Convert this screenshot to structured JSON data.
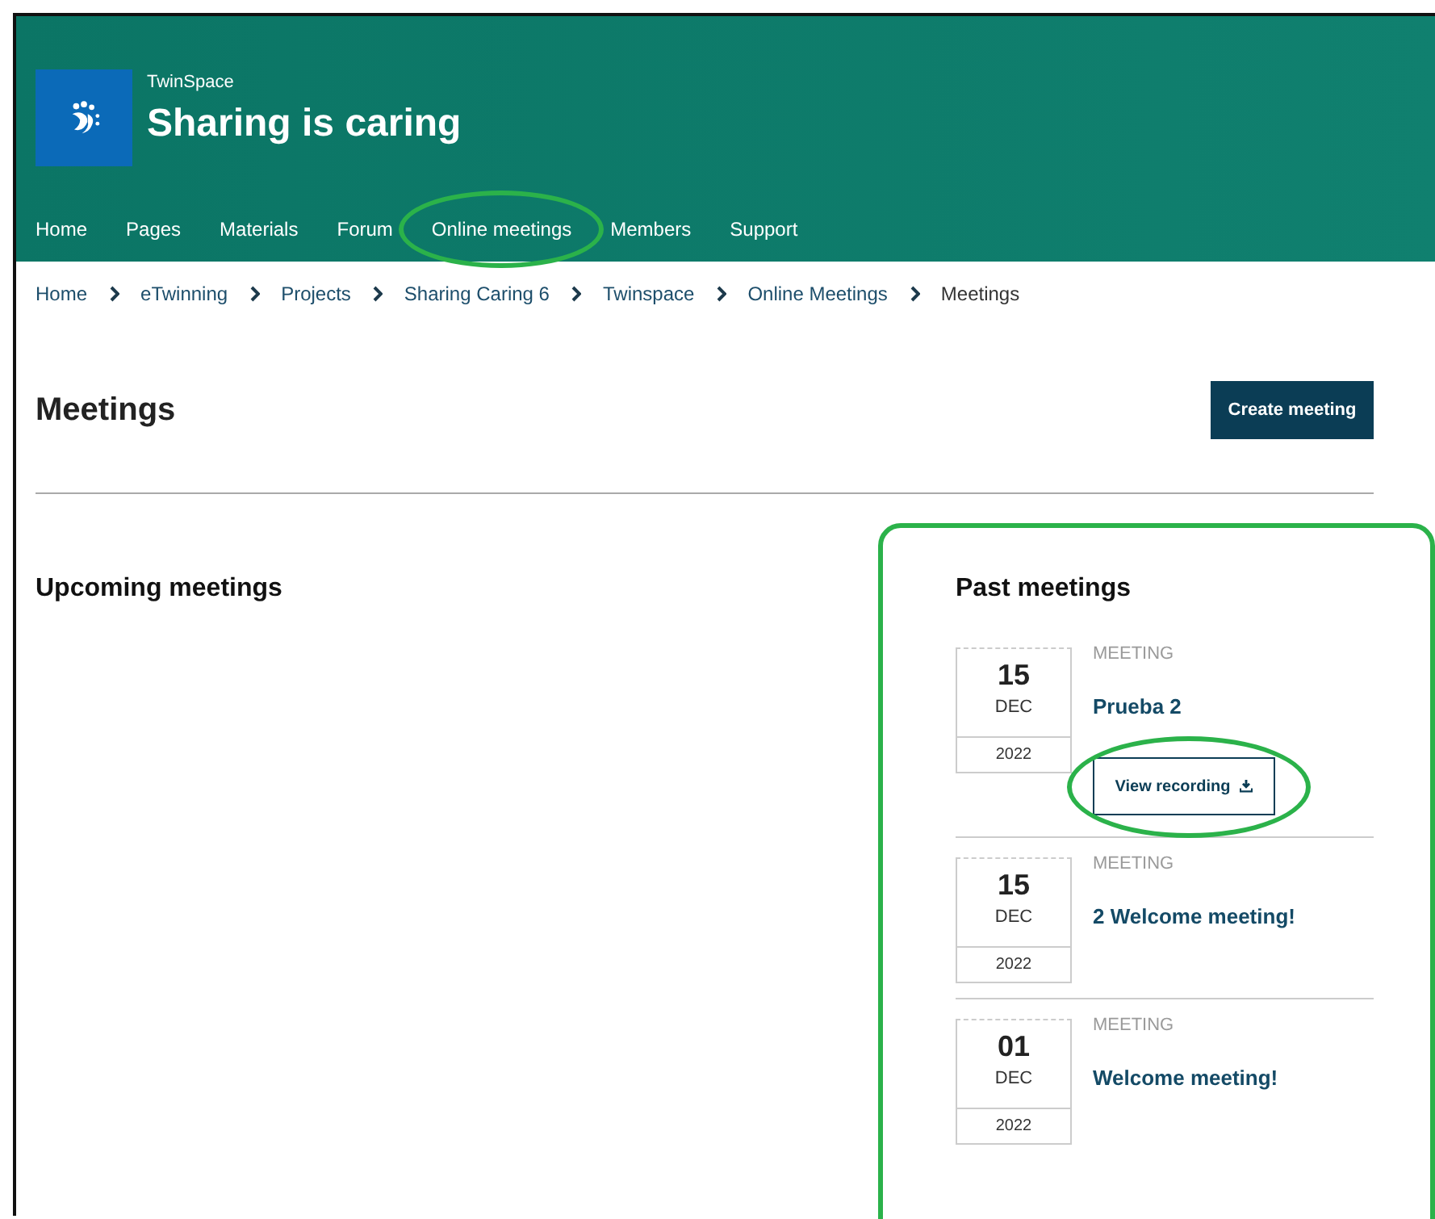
{
  "header": {
    "brand": "TwinSpace",
    "title": "Sharing is caring"
  },
  "nav_items": [
    {
      "label": "Home",
      "highlighted": false
    },
    {
      "label": "Pages",
      "highlighted": false
    },
    {
      "label": "Materials",
      "highlighted": false
    },
    {
      "label": "Forum",
      "highlighted": false
    },
    {
      "label": "Online meetings",
      "highlighted": true
    },
    {
      "label": "Members",
      "highlighted": false
    },
    {
      "label": "Support",
      "highlighted": false
    }
  ],
  "breadcrumb": [
    {
      "label": "Home",
      "link": true
    },
    {
      "label": "eTwinning",
      "link": true
    },
    {
      "label": "Projects",
      "link": true
    },
    {
      "label": "Sharing Caring 6",
      "link": true
    },
    {
      "label": "Twinspace",
      "link": true
    },
    {
      "label": "Online Meetings",
      "link": true
    },
    {
      "label": "Meetings",
      "link": false
    }
  ],
  "page_title": "Meetings",
  "create_button": "Create meeting",
  "upcoming": {
    "title": "Upcoming meetings"
  },
  "past": {
    "title": "Past meetings",
    "highlighted": true,
    "meetings": [
      {
        "day": "15",
        "month": "DEC",
        "year": "2022",
        "type": "MEETING",
        "title": "Prueba 2",
        "recording_button": {
          "label": "View recording",
          "highlighted": true
        }
      },
      {
        "day": "15",
        "month": "DEC",
        "year": "2022",
        "type": "MEETING",
        "title": "2 Welcome meeting!"
      },
      {
        "day": "01",
        "month": "DEC",
        "year": "2022",
        "type": "MEETING",
        "title": "Welcome meeting!"
      }
    ]
  }
}
